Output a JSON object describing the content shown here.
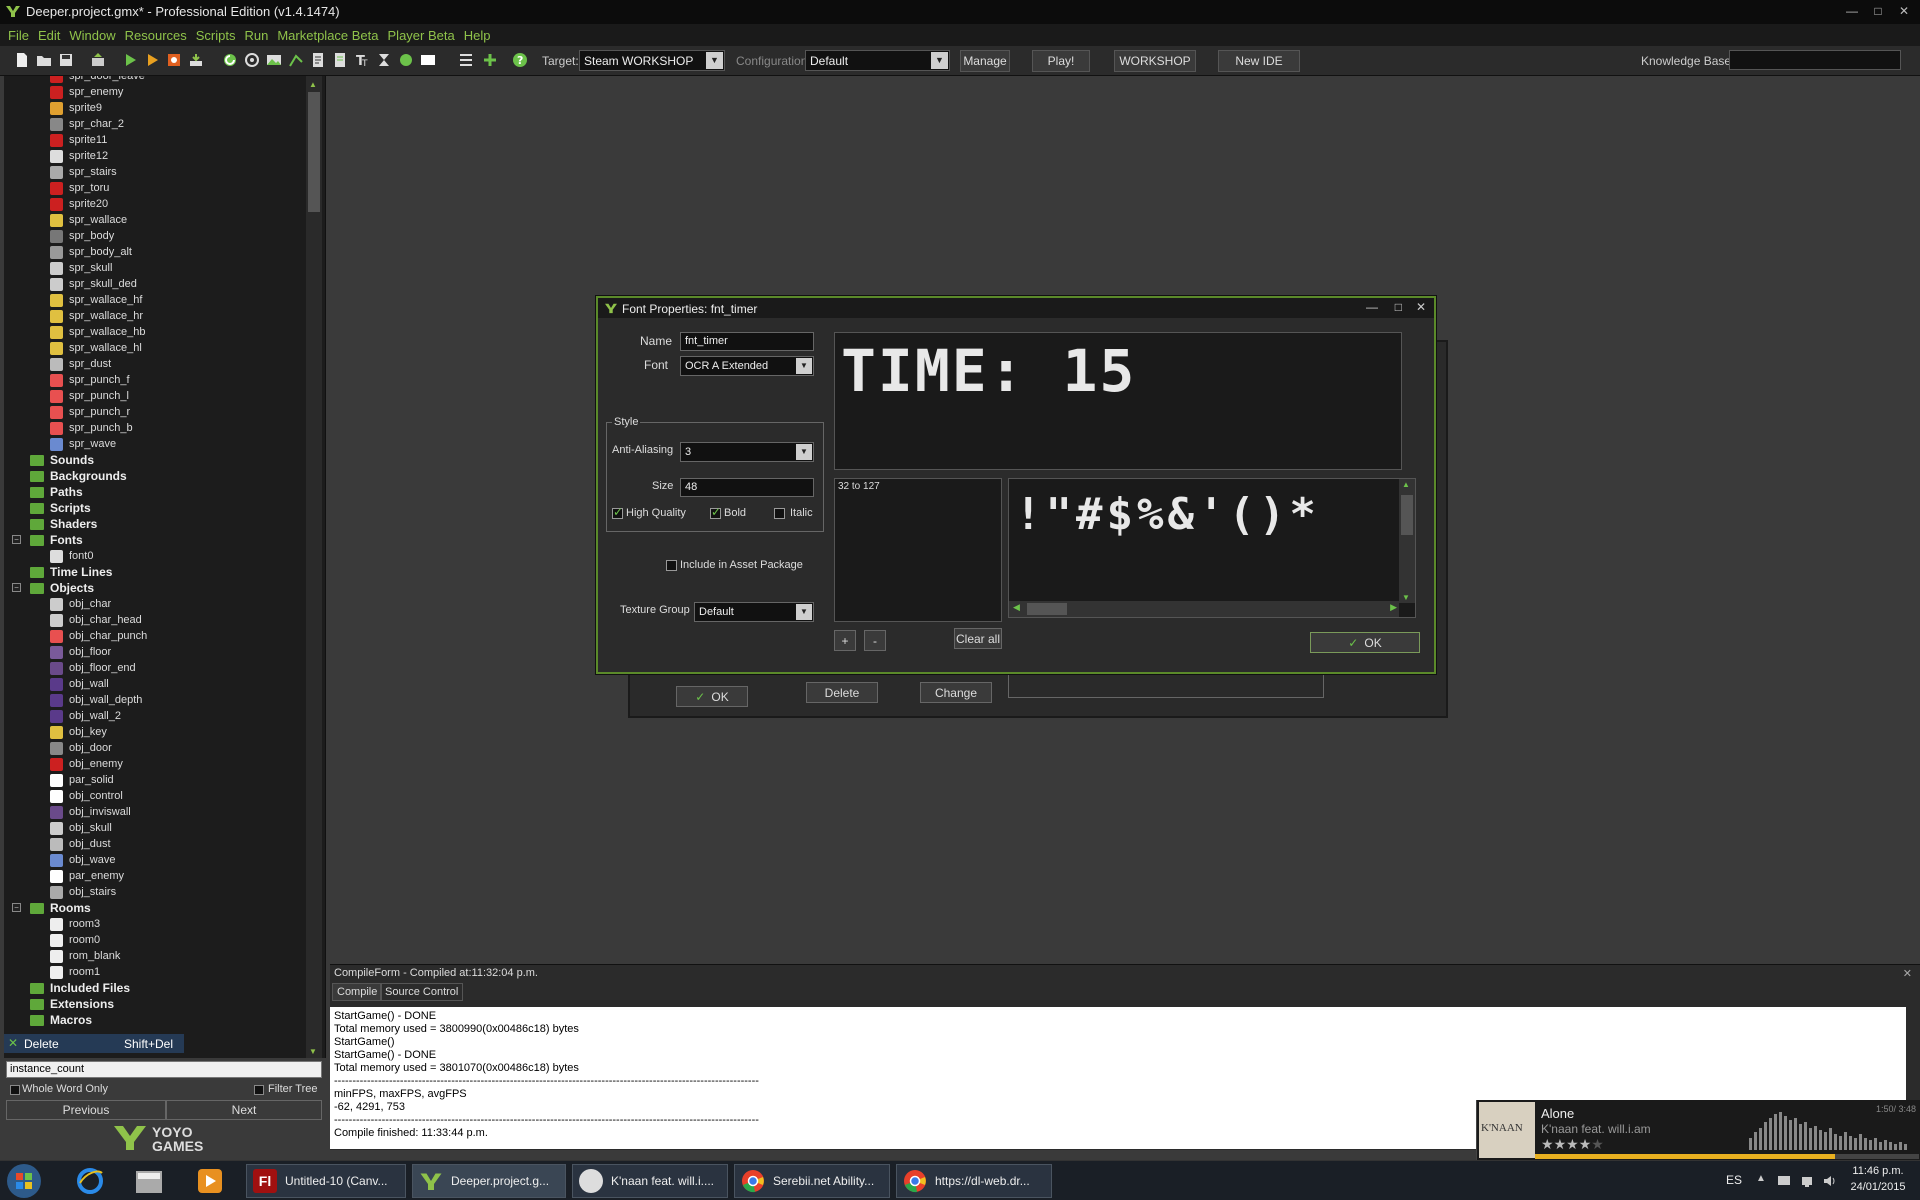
{
  "window": {
    "title": "Deeper.project.gmx* - Professional Edition (v1.4.1474)",
    "controls": [
      "minimize",
      "maximize",
      "close"
    ]
  },
  "menu": [
    "File",
    "Edit",
    "Window",
    "Resources",
    "Scripts",
    "Run",
    "Marketplace Beta",
    "Player Beta",
    "Help"
  ],
  "toolbar": {
    "target_label": "Target:",
    "target_value": "Steam WORKSHOP",
    "config_label": "Configuration:",
    "config_value": "Default",
    "manage": "Manage",
    "play": "Play!",
    "workshop": "WORKSHOP",
    "new_ide": "New IDE",
    "kb_label": "Knowledge Base:"
  },
  "tree": {
    "sprites": [
      "spr_door_leave",
      "spr_enemy",
      "sprite9",
      "spr_char_2",
      "sprite11",
      "sprite12",
      "spr_stairs",
      "spr_toru",
      "sprite20",
      "spr_wallace",
      "spr_body",
      "spr_body_alt",
      "spr_skull",
      "spr_skull_ded",
      "spr_wallace_hf",
      "spr_wallace_hr",
      "spr_wallace_hb",
      "spr_wallace_hl",
      "spr_dust",
      "spr_punch_f",
      "spr_punch_l",
      "spr_punch_r",
      "spr_punch_b",
      "spr_wave"
    ],
    "folders_a": [
      "Sounds",
      "Backgrounds",
      "Paths",
      "Scripts",
      "Shaders"
    ],
    "fonts_folder": "Fonts",
    "fonts": [
      "font0"
    ],
    "timelines_folder": "Time Lines",
    "objects_folder": "Objects",
    "objects": [
      "obj_char",
      "obj_char_head",
      "obj_char_punch",
      "obj_floor",
      "obj_floor_end",
      "obj_wall",
      "obj_wall_depth",
      "obj_wall_2",
      "obj_key",
      "obj_door",
      "obj_enemy",
      "par_solid",
      "obj_control",
      "obj_inviswall",
      "obj_skull",
      "obj_dust",
      "obj_wave",
      "par_enemy",
      "obj_stairs"
    ],
    "rooms_folder": "Rooms",
    "rooms": [
      "room3",
      "room0",
      "rom_blank",
      "room1"
    ],
    "folders_b": [
      "Included Files",
      "Extensions",
      "Macros"
    ]
  },
  "context": {
    "delete": "Delete",
    "shortcut": "Shift+Del"
  },
  "search": {
    "value": "instance_count",
    "whole_word": "Whole Word Only",
    "filter_tree": "Filter Tree",
    "previous": "Previous",
    "next": "Next"
  },
  "brand": {
    "yoyo": "YOYO",
    "games": "GAMES"
  },
  "font_dialog": {
    "title": "Font Properties: fnt_timer",
    "name_label": "Name",
    "name_value": "fnt_timer",
    "font_label": "Font",
    "font_value": "OCR A Extended",
    "style_label": "Style",
    "aa_label": "Anti-Aliasing",
    "aa_value": "3",
    "size_label": "Size",
    "size_value": "48",
    "hq_label": "High Quality",
    "bold_label": "Bold",
    "italic_label": "Italic",
    "asset_label": "Include in Asset Package",
    "texture_label": "Texture Group",
    "texture_value": "Default",
    "preview_text": "TIME: 15",
    "range_text": "32 to 127",
    "chars_text": "!\"#$%&'()*",
    "plus": "+",
    "minus": "-",
    "clear_all": "Clear all",
    "ok": "OK"
  },
  "bg_dialog": {
    "ok": "OK",
    "delete": "Delete",
    "change": "Change"
  },
  "compile": {
    "header": "CompileForm - Compiled at:11:32:04 p.m.",
    "tab_compile": "Compile",
    "tab_source": "Source Control",
    "log": "StartGame() - DONE\nTotal memory used = 3800990(0x00486c18) bytes\nStartGame()\nStartGame() - DONE\nTotal memory used = 3801070(0x00486c18) bytes\n--------------------------------------------------------------------------------------------------------------------\nminFPS, maxFPS, avgFPS\n-62, 4291, 753\n--------------------------------------------------------------------------------------------------------------------\nCompile finished: 11:33:44 p.m."
  },
  "media": {
    "title": "Alone",
    "artist": "K'naan feat. will.i.am",
    "album_art_text": "K'NAAN",
    "time": "1:50/ 3:48",
    "rating_stars": 4,
    "rating_max": 5,
    "progress": 0.78
  },
  "taskbar": {
    "tasks": [
      "Untitled-10 (Canv...",
      "Deeper.project.g...",
      "K'naan feat. will.i....",
      "Serebii.net Ability...",
      "https://dl-web.dr..."
    ],
    "lang": "ES",
    "time": "11:46 p.m.",
    "date": "24/01/2015"
  },
  "colors": {
    "accent": "#8fc24a",
    "dialog_border": "#5b8a2a"
  }
}
